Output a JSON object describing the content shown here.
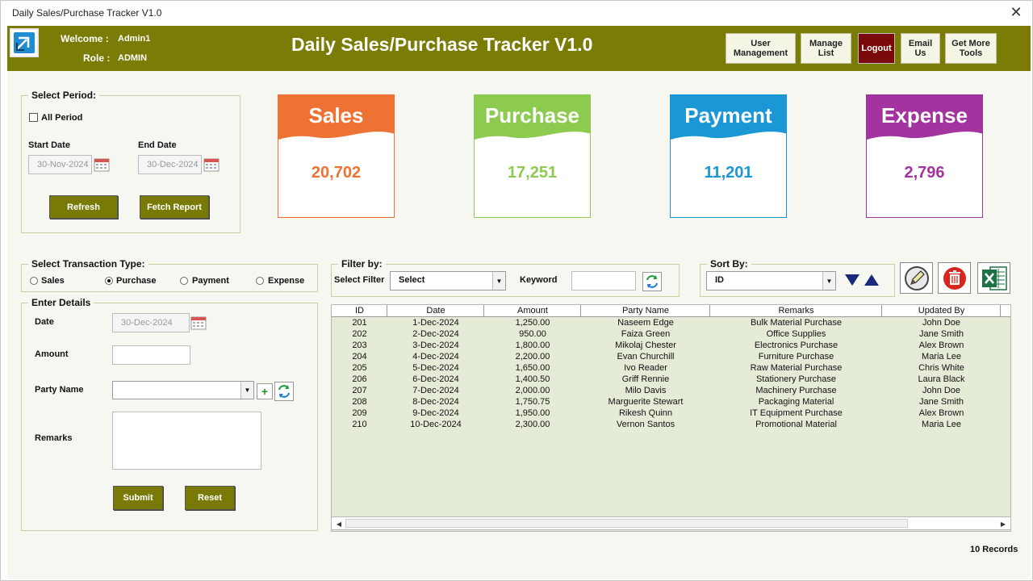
{
  "window": {
    "title": "Daily Sales/Purchase Tracker V1.0",
    "close_glyph": "✕"
  },
  "header": {
    "welcome_label": "Welcome :",
    "welcome_value": "Admin1",
    "role_label": "Role :",
    "role_value": "ADMIN",
    "app_title": "Daily Sales/Purchase Tracker V1.0",
    "buttons": {
      "user_management": "User\nManagement",
      "manage_list": "Manage\nList",
      "logout": "Logout",
      "email_us": "Email\nUs",
      "get_more_tools": "Get More\nTools"
    }
  },
  "period": {
    "legend": "Select Period:",
    "all_period_label": "All Period",
    "all_period_checked": false,
    "start_label": "Start Date",
    "start_value": "30-Nov-2024",
    "end_label": "End Date",
    "end_value": "30-Dec-2024",
    "refresh_label": "Refresh",
    "fetch_label": "Fetch Report"
  },
  "cards": {
    "sales": {
      "title": "Sales",
      "value": "20,702",
      "color": "#ee7233"
    },
    "purchase": {
      "title": "Purchase",
      "value": "17,251",
      "color": "#8ccb4f"
    },
    "payment": {
      "title": "Payment",
      "value": "11,201",
      "color": "#1a97d4"
    },
    "expense": {
      "title": "Expense",
      "value": "2,796",
      "color": "#a3339e"
    }
  },
  "transaction": {
    "legend": "Select Transaction Type:",
    "options": [
      "Sales",
      "Purchase",
      "Payment",
      "Expense"
    ],
    "selected": "Purchase"
  },
  "details": {
    "legend": "Enter Details",
    "date_label": "Date",
    "date_value": "30-Dec-2024",
    "amount_label": "Amount",
    "amount_value": "",
    "party_label": "Party Name",
    "party_value": "",
    "remarks_label": "Remarks",
    "remarks_value": "",
    "submit_label": "Submit",
    "reset_label": "Reset"
  },
  "filter": {
    "legend": "Filter by:",
    "select_filter_label": "Select Filter",
    "select_filter_value": "Select",
    "keyword_label": "Keyword",
    "keyword_value": ""
  },
  "sort": {
    "legend": "Sort By:",
    "value": "ID"
  },
  "table": {
    "columns": [
      "ID",
      "Date",
      "Amount",
      "Party Name",
      "Remarks",
      "Updated By"
    ],
    "rows": [
      [
        "201",
        "1-Dec-2024",
        "1,250.00",
        "Naseem Edge",
        "Bulk Material Purchase",
        "John Doe"
      ],
      [
        "202",
        "2-Dec-2024",
        "950.00",
        "Faiza Green",
        "Office Supplies",
        "Jane Smith"
      ],
      [
        "203",
        "3-Dec-2024",
        "1,800.00",
        "Mikolaj Chester",
        "Electronics Purchase",
        "Alex Brown"
      ],
      [
        "204",
        "4-Dec-2024",
        "2,200.00",
        "Evan Churchill",
        "Furniture Purchase",
        "Maria Lee"
      ],
      [
        "205",
        "5-Dec-2024",
        "1,650.00",
        "Ivo Reader",
        "Raw Material Purchase",
        "Chris White"
      ],
      [
        "206",
        "6-Dec-2024",
        "1,400.50",
        "Griff Rennie",
        "Stationery Purchase",
        "Laura Black"
      ],
      [
        "207",
        "7-Dec-2024",
        "2,000.00",
        "Milo Davis",
        "Machinery Purchase",
        "John Doe"
      ],
      [
        "208",
        "8-Dec-2024",
        "1,750.75",
        "Marguerite Stewart",
        "Packaging Material",
        "Jane Smith"
      ],
      [
        "209",
        "9-Dec-2024",
        "1,950.00",
        "Rikesh Quinn",
        "IT Equipment Purchase",
        "Alex Brown"
      ],
      [
        "210",
        "10-Dec-2024",
        "2,300.00",
        "Vernon Santos",
        "Promotional Material",
        "Maria Lee"
      ]
    ]
  },
  "footer": {
    "records": "10 Records"
  },
  "colors": {
    "header": "#7a7c05",
    "button": "#797a06",
    "logout": "#7a0a0a",
    "grid": "#e4ecd7"
  }
}
